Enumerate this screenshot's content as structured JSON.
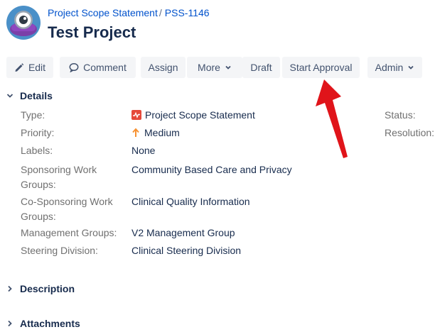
{
  "header": {
    "breadcrumb_project": "Project Scope Statement",
    "breadcrumb_separator": "/",
    "breadcrumb_issue": "PSS-1146",
    "title": "Test Project"
  },
  "toolbar": {
    "edit": "Edit",
    "comment": "Comment",
    "assign": "Assign",
    "more": "More",
    "draft": "Draft",
    "start_approval": "Start Approval",
    "admin": "Admin"
  },
  "details": {
    "heading": "Details",
    "fields": {
      "type_label": "Type:",
      "type_value": "Project Scope Statement",
      "priority_label": "Priority:",
      "priority_value": "Medium",
      "labels_label": "Labels:",
      "labels_value": "None",
      "sponsoring_label": "Sponsoring Work Groups:",
      "sponsoring_value": "Community Based Care and Privacy",
      "cosponsoring_label": "Co-Sponsoring Work Groups:",
      "cosponsoring_value": "Clinical Quality Information",
      "management_label": "Management Groups:",
      "management_value": "V2 Management Group",
      "steering_label": "Steering Division:",
      "steering_value": "Clinical Steering Division"
    },
    "right_fields": {
      "status_label": "Status:",
      "resolution_label": "Resolution:"
    }
  },
  "sections": {
    "description": "Description",
    "attachments": "Attachments"
  },
  "colors": {
    "link": "#0052cc",
    "button_bg": "#f4f5f7",
    "type_icon": "#e5493a",
    "priority_icon": "#f79232",
    "annotation_arrow": "#e0141a"
  },
  "icons": {
    "avatar": "project-avatar-icon",
    "edit": "pencil-icon",
    "comment": "comment-icon",
    "dropdown": "chevron-down-icon",
    "type": "project-scope-statement-icon",
    "priority": "arrow-up-icon",
    "expanded": "chevron-down-icon",
    "collapsed": "chevron-right-icon"
  }
}
